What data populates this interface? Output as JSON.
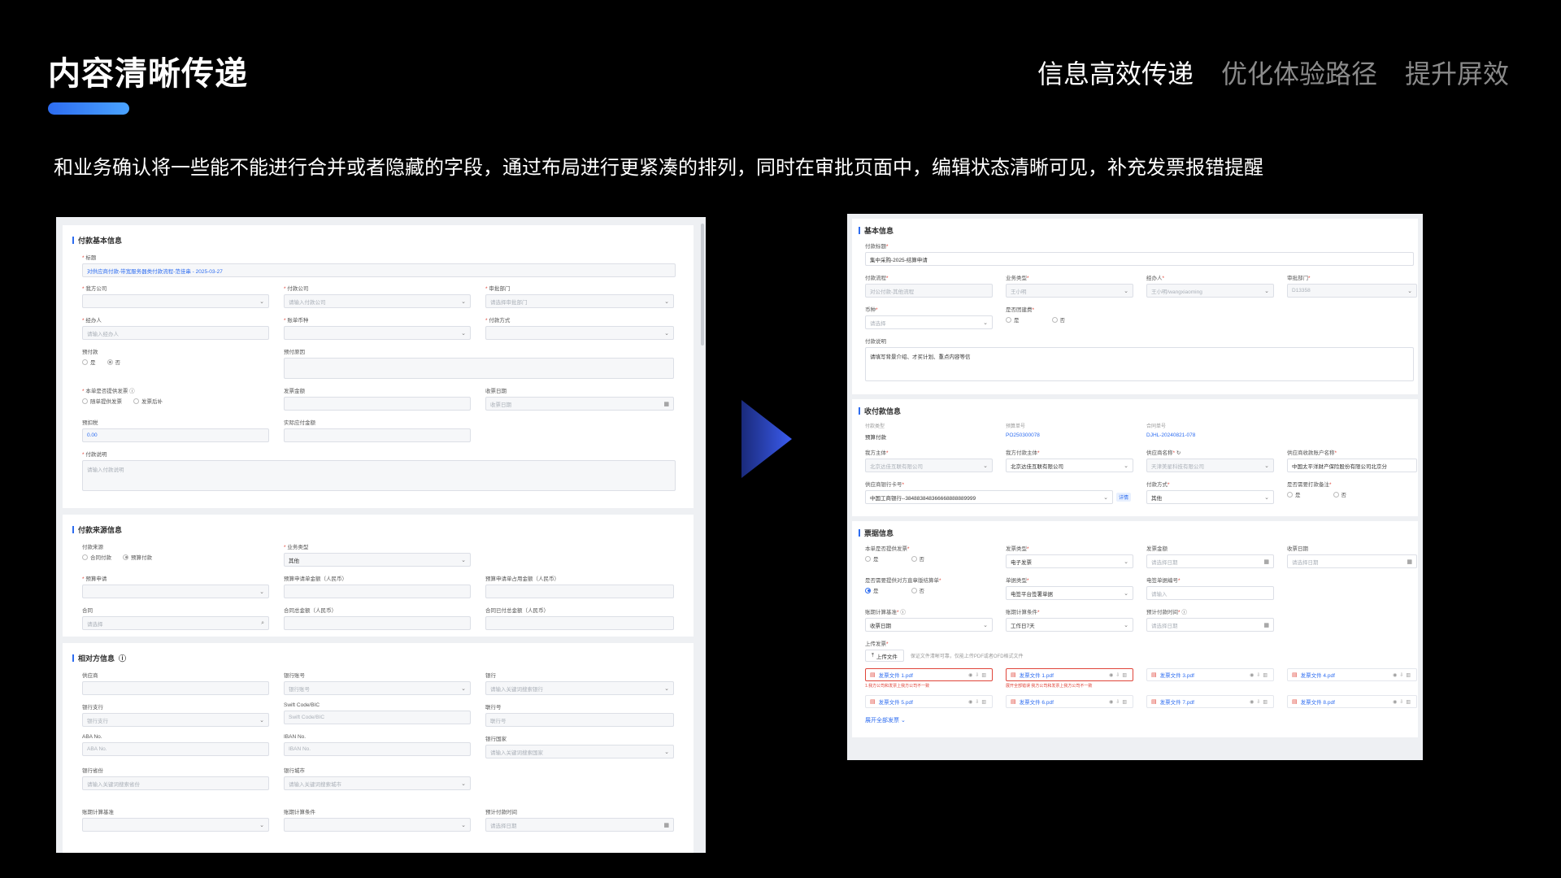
{
  "header": {
    "title": "内容清晰传递",
    "nav": [
      "信息高效传递",
      "优化体验路径",
      "提升屏效"
    ],
    "description": "和业务确认将一些能不能进行合并或者隐藏的字段，通过布局进行更紧凑的排列，同时在审批页面中，编辑状态清晰可见，补充发票报错提醒"
  },
  "colors": {
    "accent": "#2d6cf0",
    "error": "#e0453a",
    "background": "#000000"
  },
  "left": {
    "basic": {
      "title": "付款基本信息",
      "subject_label": "标题",
      "subject_value": "对供应商付款-带宽服务器类付款流程-范佳串 - 2025-03-27",
      "row1": [
        {
          "label": "我方公司",
          "placeholder": ""
        },
        {
          "label": "付款公司",
          "placeholder": "请输入付款公司"
        },
        {
          "label": "审批部门",
          "placeholder": "请选择审批部门"
        }
      ],
      "row2": [
        {
          "label": "经办人",
          "placeholder": "请输入经办人"
        },
        {
          "label": "账单币种",
          "placeholder": ""
        },
        {
          "label": "付款方式",
          "placeholder": ""
        }
      ],
      "prepay_label": "预付款",
      "prepay_yes": "是",
      "prepay_no": "否",
      "prepay_reason_label": "预付原因",
      "invoice_provided_label": "本单是否提供发票",
      "invoice_opt1": "随单提供发票",
      "invoice_opt2": "发票后补",
      "invoice_amount_label": "发票金额",
      "receipt_date_label": "收票日期",
      "receipt_date_placeholder": "收票日期",
      "pretax_label": "预扣税",
      "pretax_value": "0.00",
      "actual_label": "实际应付金额",
      "desc_label": "付款说明",
      "desc_placeholder": "请输入付款说明"
    },
    "source": {
      "title": "付款来源信息",
      "source_label": "付款来源",
      "opt_contract": "合同付款",
      "opt_budget": "预算付款",
      "biz_type_label": "业务类型",
      "biz_type_value": "其他",
      "budget_req_label": "预算申请",
      "budget_amount_label": "预算申请单金额（人民币）",
      "budget_used_label": "预算申请单占用金额（人民币）",
      "contract_label": "合同",
      "contract_placeholder": "请选择",
      "contract_amount_label": "合同总金额（人民币）",
      "contract_paid_label": "合同已付总金额（人民币）"
    },
    "counterparty": {
      "title": "相对方信息",
      "fields": [
        {
          "label": "供应商",
          "placeholder": ""
        },
        {
          "label": "银行账号",
          "placeholder": "银行账号"
        },
        {
          "label": "银行",
          "placeholder": "请输入关键词搜索银行"
        },
        {
          "label": "银行支行",
          "placeholder": "银行支行"
        },
        {
          "label": "Swift Code/BIC",
          "placeholder": "Swift Code/BIC"
        },
        {
          "label": "联行号",
          "placeholder": "联行号"
        },
        {
          "label": "ABA No.",
          "placeholder": "ABA No."
        },
        {
          "label": "IBAN No.",
          "placeholder": "IBAN No."
        },
        {
          "label": "银行国家",
          "placeholder": "请输入关键词搜索国家"
        },
        {
          "label": "银行省份",
          "placeholder": "请输入关键词搜索省份"
        },
        {
          "label": "银行城市",
          "placeholder": "请输入关键词搜索城市"
        }
      ],
      "bottom": [
        {
          "label": "账期计算基准",
          "placeholder": ""
        },
        {
          "label": "账期计算条件",
          "placeholder": ""
        },
        {
          "label": "预计付款时间",
          "placeholder": "请选择日期"
        }
      ]
    }
  },
  "right": {
    "basic": {
      "title": "基本信息",
      "subject_label": "付款标题",
      "subject_value": "集中采购-2025-结算申请",
      "row1": [
        {
          "label": "付款流程",
          "value": "对公付款-其他流程"
        },
        {
          "label": "业务类型",
          "value": "王小明"
        },
        {
          "label": "经办人",
          "value": "王小明/wangxiaoming"
        },
        {
          "label": "审批部门",
          "value": "D13358"
        }
      ],
      "currency_label": "币种",
      "currency_placeholder": "请选择",
      "group_label": "是否团建费",
      "yes": "是",
      "no": "否",
      "desc_label": "付款说明",
      "desc_value": "请填写背景介绍、才买计划、重点内容等信"
    },
    "payee": {
      "title": "收付款信息",
      "row1": [
        {
          "label": "付款类型",
          "value": "预算付款"
        },
        {
          "label": "预算单号",
          "value": "PO250300078"
        },
        {
          "label": "合同单号",
          "value": "DJHL-20240821-078"
        }
      ],
      "row2": [
        {
          "label": "我方主体",
          "value": "北京达佳互联有限公司"
        },
        {
          "label": "我方付款主体",
          "value": "北京达佳互联有限公司"
        },
        {
          "label": "供应商名称",
          "value": "天津美星科技有限公司"
        },
        {
          "label": "供应商收款账户名称",
          "value": "中国太平洋财产保险股份有限公司北京分"
        }
      ],
      "bank_card_label": "供应商银行卡号",
      "bank_card_value": "中国工商银行--384883848366668888889999",
      "detail": "详情",
      "pay_method_label": "付款方式",
      "pay_method_value": "其他",
      "note_label": "是否需要打款备注",
      "yes": "是",
      "no": "否"
    },
    "invoice": {
      "title": "票据信息",
      "provided_label": "本单是否提供发票",
      "type_label": "发票类型",
      "type_value": "电子发票",
      "amount_label": "发票金额",
      "amount_placeholder": "请选择日期",
      "receipt_label": "收票日期",
      "receipt_placeholder": "请选择日期",
      "settle_label": "是否需要提供对方直章版结算单",
      "bill_type_label": "单据类型",
      "bill_type_value": "电签平台签署单据",
      "bill_no_label": "电签单据编号",
      "bill_no_placeholder": "请输入",
      "period_base_label": "账期计算基准",
      "period_base_value": "收票日期",
      "period_cond_label": "账期计算条件",
      "period_cond_value": "工作日7天",
      "est_time_label": "预计付款时间",
      "est_time_placeholder": "请选择日期",
      "yes": "是",
      "no": "否",
      "upload_label": "上传发票",
      "upload_button": "上传文件",
      "upload_hint": "保证文件清晰可靠，仅能上传PDF或者OFD格式文件",
      "files": [
        {
          "name": "发票文件 1.pdf",
          "error": "1.我方公司和发票上我方公司不一致",
          "link": ""
        },
        {
          "name": "发票文件 1.pdf",
          "error": "我方公司和发票上我方公司不一致",
          "link": "展开全部错误"
        },
        {
          "name": "发票文件 3.pdf",
          "error": "",
          "link": ""
        },
        {
          "name": "发票文件 4.pdf",
          "error": "",
          "link": ""
        },
        {
          "name": "发票文件 5.pdf",
          "error": "",
          "link": ""
        },
        {
          "name": "发票文件 6.pdf",
          "error": "",
          "link": ""
        },
        {
          "name": "发票文件 7.pdf",
          "error": "",
          "link": ""
        },
        {
          "name": "发票文件 8.pdf",
          "error": "",
          "link": ""
        }
      ],
      "expand_all": "展开全部发票"
    }
  }
}
